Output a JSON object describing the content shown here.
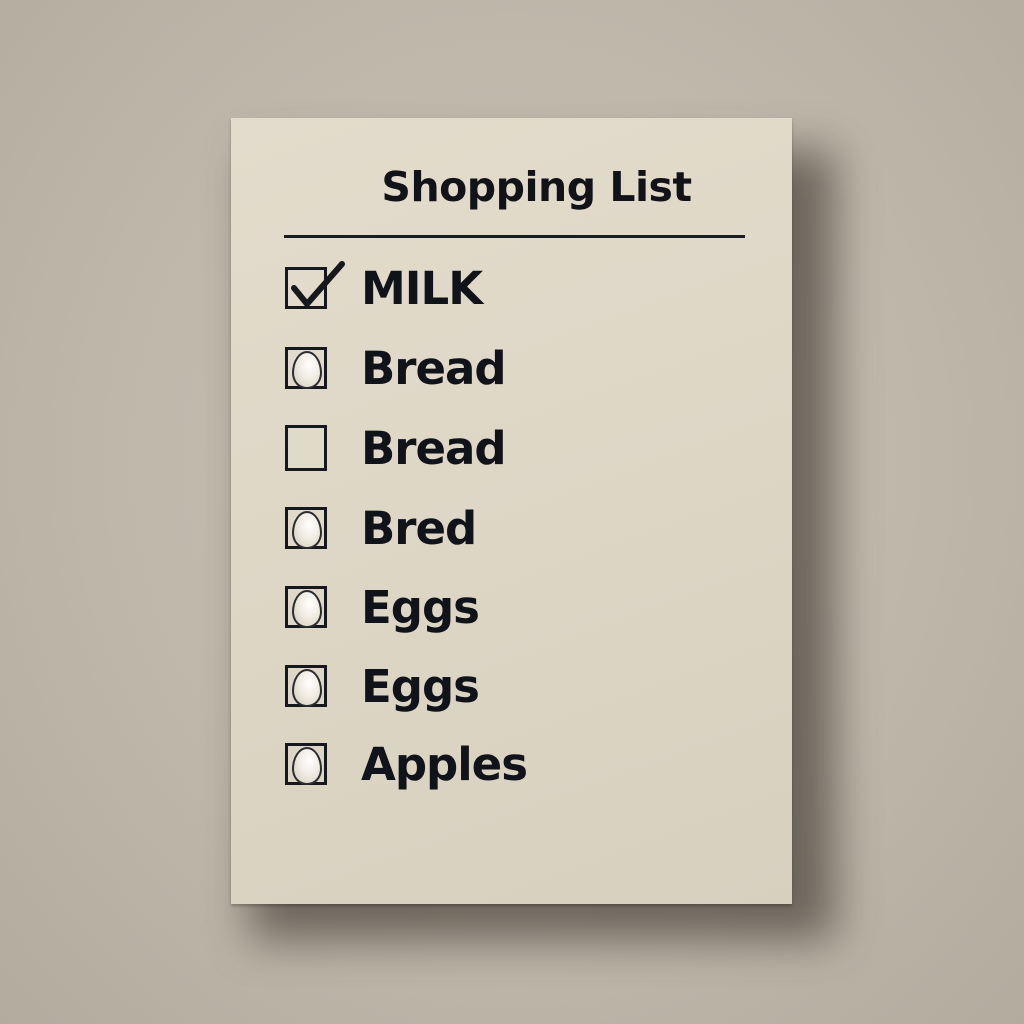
{
  "title": "Shopping List",
  "colors": {
    "background": "#bfb7aa",
    "paper": "#ddd5c4",
    "ink": "#11131a"
  },
  "items": [
    {
      "label": "MILK",
      "checkbox": "checked",
      "icon": "check-icon"
    },
    {
      "label": "Bread",
      "checkbox": "egg",
      "icon": "egg-icon"
    },
    {
      "label": "Bread",
      "checkbox": "empty",
      "icon": ""
    },
    {
      "label": "Bred",
      "checkbox": "egg",
      "icon": "egg-icon"
    },
    {
      "label": "Eggs",
      "checkbox": "egg",
      "icon": "egg-icon"
    },
    {
      "label": "Eggs",
      "checkbox": "egg",
      "icon": "egg-icon"
    },
    {
      "label": "Apples",
      "checkbox": "egg",
      "icon": "egg-icon"
    }
  ]
}
